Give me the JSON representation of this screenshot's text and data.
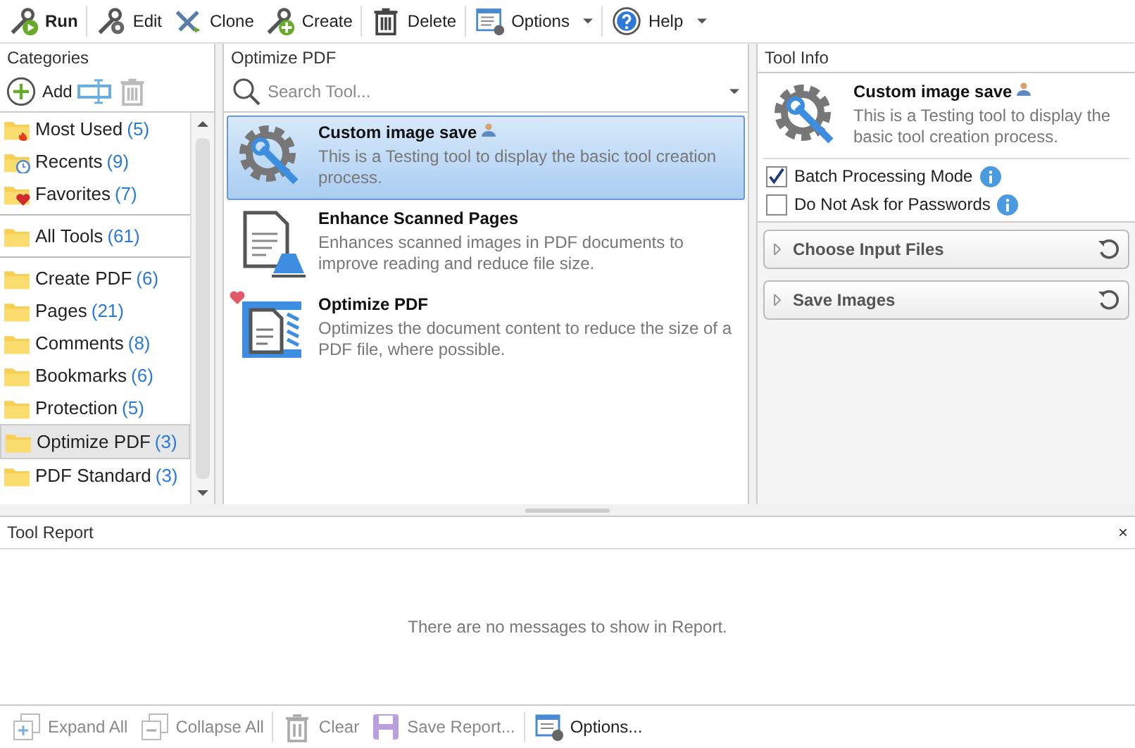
{
  "toolbar": [
    {
      "kind": "run",
      "label": "Run",
      "bold": true,
      "dropdown": false
    },
    {
      "kind": "edit",
      "label": "Edit",
      "bold": false,
      "dropdown": false
    },
    {
      "kind": "clone",
      "label": "Clone",
      "bold": false,
      "dropdown": false
    },
    {
      "kind": "create",
      "label": "Create",
      "bold": false,
      "dropdown": false
    },
    {
      "kind": "delete",
      "label": "Delete",
      "bold": false,
      "dropdown": false
    },
    {
      "kind": "options",
      "label": "Options",
      "bold": false,
      "dropdown": true
    },
    {
      "kind": "help",
      "label": "Help",
      "bold": false,
      "dropdown": true
    }
  ],
  "categories": {
    "title": "Categories",
    "add_label": "Add",
    "groups": [
      [
        {
          "kind": "fire",
          "name": "Most Used",
          "count": "(5)",
          "selected": false
        },
        {
          "kind": "clock",
          "name": "Recents",
          "count": "(9)",
          "selected": false
        },
        {
          "kind": "heart",
          "name": "Favorites",
          "count": "(7)",
          "selected": false
        }
      ],
      [
        {
          "kind": "plain",
          "name": "All Tools",
          "count": "(61)",
          "selected": false
        }
      ],
      [
        {
          "kind": "plain",
          "name": "Create PDF",
          "count": "(6)",
          "selected": false
        },
        {
          "kind": "plain",
          "name": "Pages",
          "count": "(21)",
          "selected": false
        },
        {
          "kind": "plain",
          "name": "Comments",
          "count": "(8)",
          "selected": false
        },
        {
          "kind": "plain",
          "name": "Bookmarks",
          "count": "(6)",
          "selected": false
        },
        {
          "kind": "plain",
          "name": "Protection",
          "count": "(5)",
          "selected": false
        },
        {
          "kind": "plain",
          "name": "Optimize PDF",
          "count": "(3)",
          "selected": true
        },
        {
          "kind": "plain",
          "name": "PDF Standard",
          "count": "(3)",
          "selected": false
        }
      ]
    ]
  },
  "tools": {
    "title": "Optimize PDF",
    "search": {
      "placeholder": "Search Tool..."
    },
    "items": [
      {
        "kind": "gear",
        "name": "Custom image save",
        "user": true,
        "favorite": false,
        "description": "This is a Testing tool to display the basic tool creation process.",
        "selected": true
      },
      {
        "kind": "scan",
        "name": "Enhance Scanned Pages",
        "user": false,
        "favorite": false,
        "description": "Enhances scanned images in PDF documents to improve reading and reduce file size.",
        "selected": false
      },
      {
        "kind": "optimize",
        "name": "Optimize PDF",
        "user": false,
        "favorite": true,
        "description": "Optimizes the document content to reduce the size of a PDF file, where possible.",
        "selected": false
      }
    ]
  },
  "tool_info": {
    "title": "Tool Info",
    "name": "Custom image save",
    "user": true,
    "description": "This is a Testing tool to display the basic tool creation process.",
    "options": [
      {
        "label": "Batch Processing Mode",
        "checked": true
      },
      {
        "label": "Do Not Ask for Passwords",
        "checked": false
      }
    ],
    "sections": [
      {
        "label": "Choose Input Files",
        "expanded": false
      },
      {
        "label": "Save Images",
        "expanded": false
      }
    ]
  },
  "report": {
    "title": "Tool Report",
    "close": "×",
    "empty_message": "There are no messages to show in Report."
  },
  "bottom_bar": [
    {
      "kind": "expand",
      "label": "Expand All",
      "disabled": true
    },
    {
      "kind": "collapse",
      "label": "Collapse All",
      "disabled": true
    },
    {
      "kind": "clear",
      "label": "Clear",
      "disabled": true
    },
    {
      "kind": "save",
      "label": "Save Report...",
      "disabled": true
    },
    {
      "kind": "options",
      "label": "Options...",
      "disabled": false
    }
  ]
}
